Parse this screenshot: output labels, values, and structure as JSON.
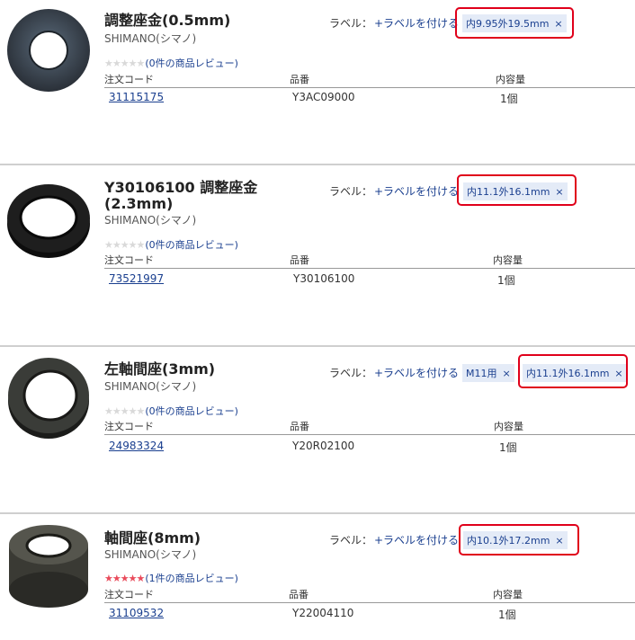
{
  "common": {
    "label_caption": "ラベル：",
    "add_label": "+ラベルを付ける",
    "col_code": "注文コード",
    "col_part": "品番",
    "col_qty": "内容量",
    "tag_close": "×"
  },
  "products": [
    {
      "title": "調整座金(0.5mm)",
      "maker": "SHIMANO(シマノ)",
      "stars": "★★★★★",
      "review": "(0件の商品レビュー)",
      "tags": [
        "内9.95外19.5mm"
      ],
      "code": "31115175",
      "part": "Y3AC09000",
      "qty": "1個"
    },
    {
      "title": "Y30106100 調整座金(2.3mm)",
      "maker": "SHIMANO(シマノ)",
      "stars": "★★★★★",
      "review": "(0件の商品レビュー)",
      "tags": [
        "内11.1外16.1mm"
      ],
      "code": "73521997",
      "part": "Y30106100",
      "qty": "1個"
    },
    {
      "title": "左軸間座(3mm)",
      "maker": "SHIMANO(シマノ)",
      "stars": "★★★★★",
      "review": "(0件の商品レビュー)",
      "tags": [
        "M11用",
        "内11.1外16.1mm"
      ],
      "code": "24983324",
      "part": "Y20R02100",
      "qty": "1個"
    },
    {
      "title": "軸間座(8mm)",
      "maker": "SHIMANO(シマノ)",
      "stars": "★★★★★",
      "review": "(1件の商品レビュー)",
      "tags": [
        "内10.1外17.2mm"
      ],
      "code": "31109532",
      "part": "Y22004110",
      "qty": "1個"
    }
  ]
}
